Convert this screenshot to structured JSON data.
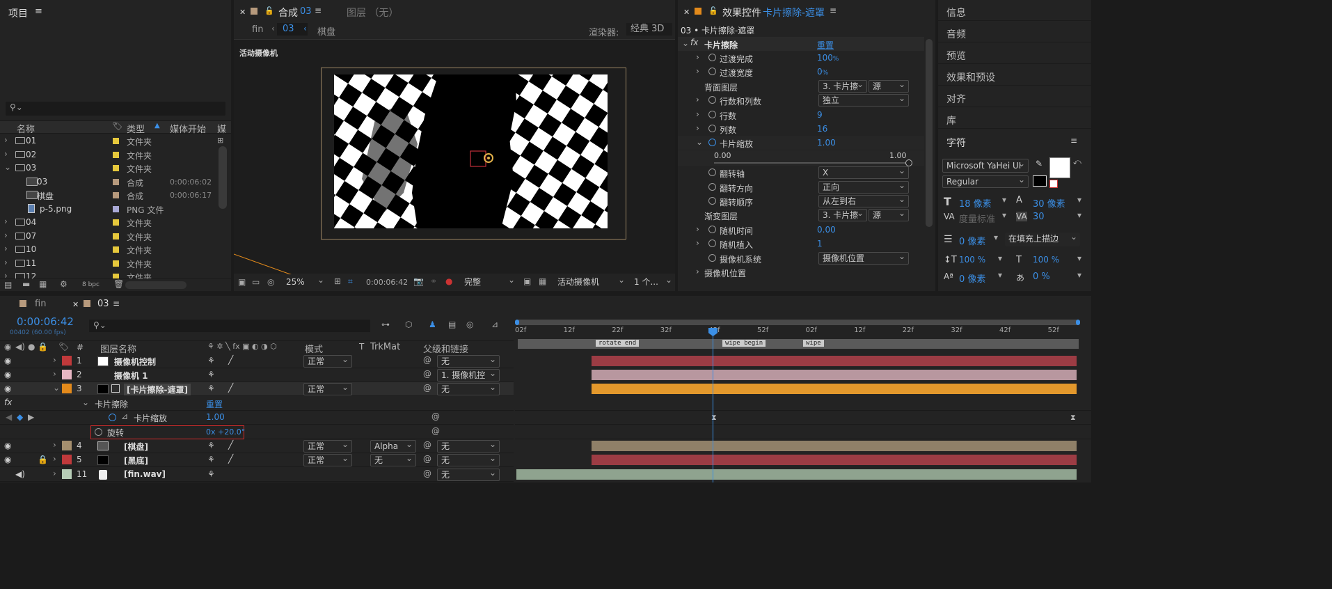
{
  "project": {
    "title": "项目",
    "search_placeholder": "",
    "columns": {
      "name": "名称",
      "type": "类型",
      "media_start": "媒体开始",
      "media_more": "媒"
    },
    "items": [
      {
        "indent": 0,
        "expand": "›",
        "icon": "folder",
        "name": "01",
        "color": "#e6c83c",
        "type": "文件夹",
        "start": ""
      },
      {
        "indent": 0,
        "expand": "›",
        "icon": "folder",
        "name": "02",
        "color": "#e6c83c",
        "type": "文件夹",
        "start": ""
      },
      {
        "indent": 0,
        "expand": "⌄",
        "icon": "folder",
        "name": "03",
        "color": "#e6c83c",
        "type": "文件夹",
        "start": ""
      },
      {
        "indent": 1,
        "expand": "",
        "icon": "comp",
        "name": "03",
        "color": "#b79a7d",
        "type": "合成",
        "start": "0:00:06:02"
      },
      {
        "indent": 1,
        "expand": "",
        "icon": "comp",
        "name": "棋盘",
        "color": "#b79a7d",
        "type": "合成",
        "start": "0:00:06:17"
      },
      {
        "indent": 1,
        "expand": "",
        "icon": "png",
        "name": "p-5.png",
        "color": "#a9a9d6",
        "type": "PNG 文件",
        "start": ""
      },
      {
        "indent": 0,
        "expand": "›",
        "icon": "folder",
        "name": "04",
        "color": "#e6c83c",
        "type": "文件夹",
        "start": ""
      },
      {
        "indent": 0,
        "expand": "›",
        "icon": "folder",
        "name": "07",
        "color": "#e6c83c",
        "type": "文件夹",
        "start": ""
      },
      {
        "indent": 0,
        "expand": "›",
        "icon": "folder",
        "name": "10",
        "color": "#e6c83c",
        "type": "文件夹",
        "start": ""
      },
      {
        "indent": 0,
        "expand": "›",
        "icon": "folder",
        "name": "11",
        "color": "#e6c83c",
        "type": "文件夹",
        "start": ""
      },
      {
        "indent": 0,
        "expand": "›",
        "icon": "folder",
        "name": "12",
        "color": "#e6c83c",
        "type": "文件夹",
        "start": ""
      }
    ],
    "footer": {
      "bpc": "8 bpc"
    }
  },
  "comp": {
    "tab_label": "合成",
    "tab_name": "03",
    "layer_tab": "图层 （无）",
    "breadcrumb": {
      "parent": "fin",
      "current": "03",
      "child": "棋盘"
    },
    "renderer_label": "渲染器:",
    "renderer": "经典 3D",
    "camera_label": "活动摄像机",
    "toolbar": {
      "zoom": "25%",
      "timecode": "0:00:06:42",
      "quality": "完整",
      "camera": "活动摄像机",
      "views": "1 个..."
    }
  },
  "effects": {
    "tab_label": "效果控件",
    "tab_layer": "卡片擦除-遮罩",
    "path": "03 • 卡片擦除-遮罩",
    "effect_name": "卡片擦除",
    "reset": "重置",
    "props": [
      {
        "expand": "›",
        "sw": true,
        "name": "过渡完成",
        "value": "100",
        "unit": "%",
        "kind": "value"
      },
      {
        "expand": "›",
        "sw": true,
        "name": "过渡宽度",
        "value": "0",
        "unit": "%",
        "kind": "value"
      },
      {
        "expand": "",
        "sw": false,
        "name": "背面图层",
        "value": "3. 卡片擦",
        "value2": "源",
        "kind": "dual"
      },
      {
        "expand": "›",
        "sw": true,
        "name": "行数和列数",
        "value": "独立",
        "kind": "dropdown"
      },
      {
        "expand": "›",
        "sw": true,
        "name": "行数",
        "value": "9",
        "unit": "",
        "kind": "value"
      },
      {
        "expand": "›",
        "sw": true,
        "name": "列数",
        "value": "16",
        "unit": "",
        "kind": "value"
      },
      {
        "expand": "⌄",
        "sw": true,
        "active": true,
        "name": "卡片缩放",
        "value": "1.00",
        "unit": "",
        "kind": "value"
      },
      {
        "expand": "",
        "sw": false,
        "name": "",
        "kind": "slider",
        "min": "0.00",
        "max": "1.00",
        "fraction": 1.0
      },
      {
        "expand": "",
        "sw": true,
        "name": "翻转轴",
        "value": "X",
        "kind": "dropdown"
      },
      {
        "expand": "",
        "sw": true,
        "name": "翻转方向",
        "value": "正向",
        "kind": "dropdown"
      },
      {
        "expand": "",
        "sw": true,
        "name": "翻转顺序",
        "value": "从左到右",
        "kind": "dropdown"
      },
      {
        "expand": "",
        "sw": false,
        "name": "渐变图层",
        "value": "3. 卡片擦",
        "value2": "源",
        "kind": "dual"
      },
      {
        "expand": "›",
        "sw": true,
        "name": "随机时间",
        "value": "0.00",
        "unit": "",
        "kind": "value"
      },
      {
        "expand": "›",
        "sw": true,
        "name": "随机植入",
        "value": "1",
        "unit": "",
        "kind": "value"
      },
      {
        "expand": "",
        "sw": true,
        "name": "摄像机系统",
        "value": "摄像机位置",
        "kind": "dropdown"
      },
      {
        "expand": "›",
        "sw": false,
        "name": "摄像机位置",
        "kind": "group"
      }
    ]
  },
  "right_panels": {
    "items": [
      "信息",
      "音频",
      "预览",
      "效果和预设",
      "对齐",
      "库"
    ],
    "char_title": "字符",
    "font": "Microsoft YaHei UI",
    "style": "Regular",
    "size": "18 像素",
    "leading": "30 像素",
    "kerning": "度量标准",
    "tracking": "30",
    "stroke": "0 像素",
    "stroke_mode": "在填充上描边",
    "vscale": "100 %",
    "hscale": "100 %",
    "baseline": "0 像素",
    "tsume": "0 %"
  },
  "timeline": {
    "tabs": [
      "fin",
      "03"
    ],
    "timecode": "0:00:06:42",
    "frame_info": "00402 (60.00 fps)",
    "headers": {
      "num": "#",
      "name": "图层名称",
      "mode": "模式",
      "t": "T",
      "trkmat": "TrkMat",
      "parent": "父级和链接"
    },
    "ruler": [
      "02f",
      "12f",
      "22f",
      "32f",
      "42f",
      "52f",
      "02f",
      "12f",
      "22f",
      "32f",
      "42f",
      "52f"
    ],
    "markers": [
      "rotate end",
      "wipe begin",
      "wipe"
    ],
    "layers": [
      {
        "num": "1",
        "color": "#c0393b",
        "thumb": "#ffffff",
        "name": "摄像机控制",
        "mode": "正常",
        "trk": "",
        "parent": "无",
        "bar": "#9c3c44",
        "bold": true
      },
      {
        "num": "2",
        "color": "#e7b6c3",
        "thumb": "",
        "name": "摄像机 1",
        "mode": "",
        "trk": "",
        "parent": "1. 摄像机控",
        "bar": "#b8979f",
        "bold": true
      },
      {
        "num": "3",
        "color": "#e38a1b",
        "thumb": "#000000",
        "name": "[卡片擦除-遮罩]",
        "mode": "正常",
        "trk": "",
        "parent": "无",
        "bar": "#e3982c",
        "bold": true
      },
      {
        "num": "4",
        "color": "#a58f6e",
        "thumb": "comp",
        "name": "[棋盘]",
        "mode": "正常",
        "trk": "Alpha",
        "parent": "无",
        "bar": "#8f8068",
        "bold": true
      },
      {
        "num": "5",
        "color": "#c0393b",
        "thumb": "#000000",
        "name": "[黑底]",
        "mode": "正常",
        "trk": "无",
        "parent": "无",
        "bar": "#9c3c44",
        "bold": true
      },
      {
        "num": "11",
        "color": "#b7cdb7",
        "thumb": "audio",
        "name": "[fin.wav]",
        "mode": "",
        "trk": "",
        "parent": "无",
        "bar": "#8fa38f",
        "bold": true
      }
    ],
    "fx_label": "卡片擦除",
    "fx_reset": "重置",
    "prop_label": "卡片缩放",
    "prop_value": "1.00",
    "rotate_label": "旋转",
    "rotate_value": "0x +20.0°"
  }
}
